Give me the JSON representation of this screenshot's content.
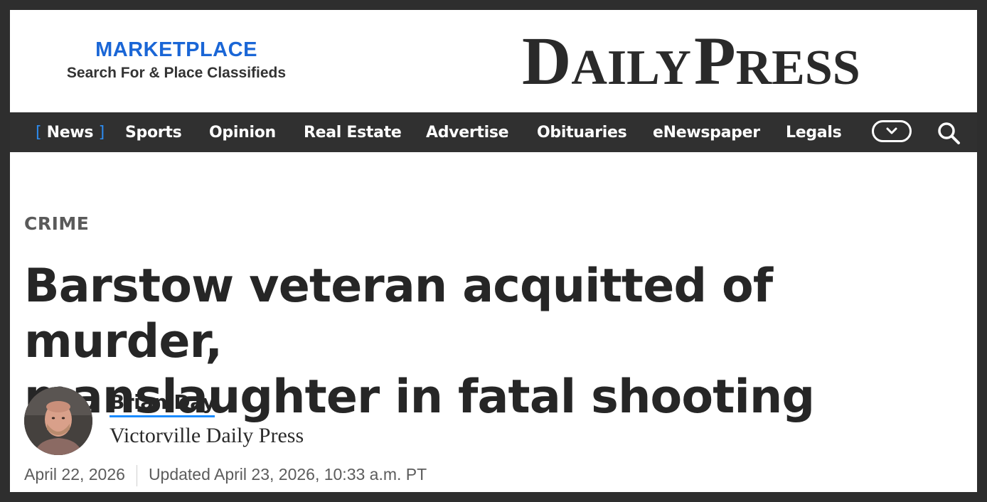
{
  "header": {
    "marketplace": {
      "title": "MARKETPLACE",
      "subtitle": "Search For & Place Classifieds"
    },
    "logo": {
      "word1_initial": "D",
      "word1_rest": "AILY",
      "word2_initial": "P",
      "word2_rest": "RESS"
    }
  },
  "nav": {
    "items": [
      {
        "label": "News",
        "active": true
      },
      {
        "label": "Sports"
      },
      {
        "label": "Opinion"
      },
      {
        "label": "Real Estate"
      },
      {
        "label": "Advertise"
      },
      {
        "label": "Obituaries"
      },
      {
        "label": "eNewspaper"
      },
      {
        "label": "Legals"
      }
    ],
    "active_bracket_open": "[",
    "active_bracket_close": "]",
    "more_icon": "chevron-down-icon",
    "search_icon": "search-icon",
    "colors": {
      "background": "#303030",
      "accent": "#2d8cf0",
      "text": "#ffffff"
    }
  },
  "article": {
    "kicker": "CRIME",
    "headline_line1": "Barstow veteran acquitted of murder,",
    "headline_line2": "manslaughter in fatal shooting",
    "author": {
      "name": "Brian Day",
      "publication": "Victorville Daily Press"
    },
    "published": "April 22, 2026",
    "updated": "Updated April 23, 2026, 10:33 a.m. PT"
  },
  "colors": {
    "marketplace_blue": "#1a66d6",
    "author_underline": "#1a8cff",
    "frame": "#2e2e2e"
  }
}
